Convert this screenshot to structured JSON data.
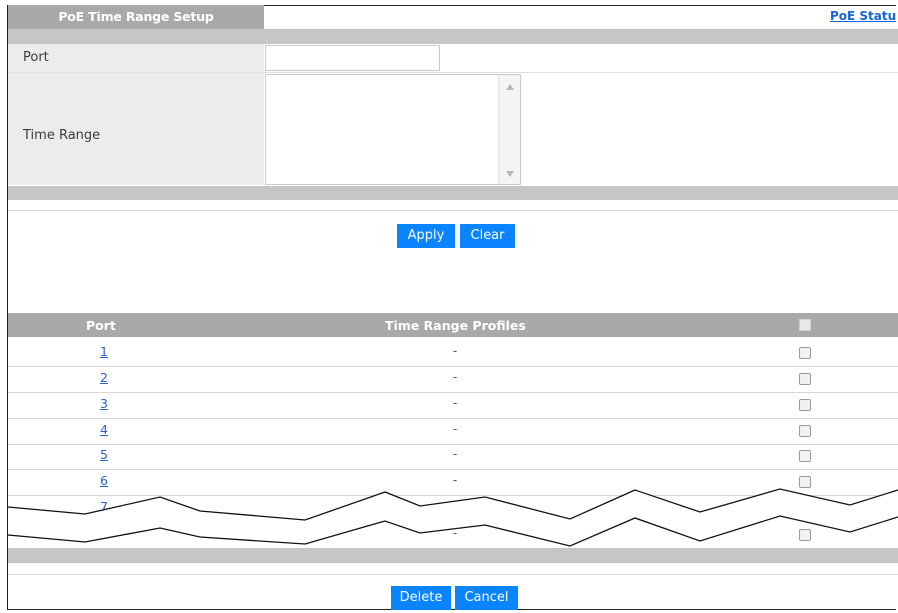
{
  "header": {
    "title": "PoE Time Range Setup",
    "status_link": "PoE Statu"
  },
  "form": {
    "port_label": "Port",
    "port_value": "",
    "time_range_label": "Time Range",
    "time_range_value": ""
  },
  "buttons": {
    "apply": "Apply",
    "clear": "Clear",
    "delete": "Delete",
    "cancel": "Cancel"
  },
  "table": {
    "headers": {
      "port": "Port",
      "profiles": "Time Range Profiles"
    },
    "rows": [
      {
        "port": "1",
        "profile": "-"
      },
      {
        "port": "2",
        "profile": "-"
      },
      {
        "port": "3",
        "profile": "-"
      },
      {
        "port": "4",
        "profile": "-"
      },
      {
        "port": "5",
        "profile": "-"
      },
      {
        "port": "6",
        "profile": "-"
      },
      {
        "port": "7",
        "profile": ""
      }
    ],
    "last_row_profile": "-"
  },
  "icons": {
    "scroll_up": "triangle-up-icon",
    "scroll_down": "triangle-down-icon",
    "break": "zigzag-break-icon"
  }
}
